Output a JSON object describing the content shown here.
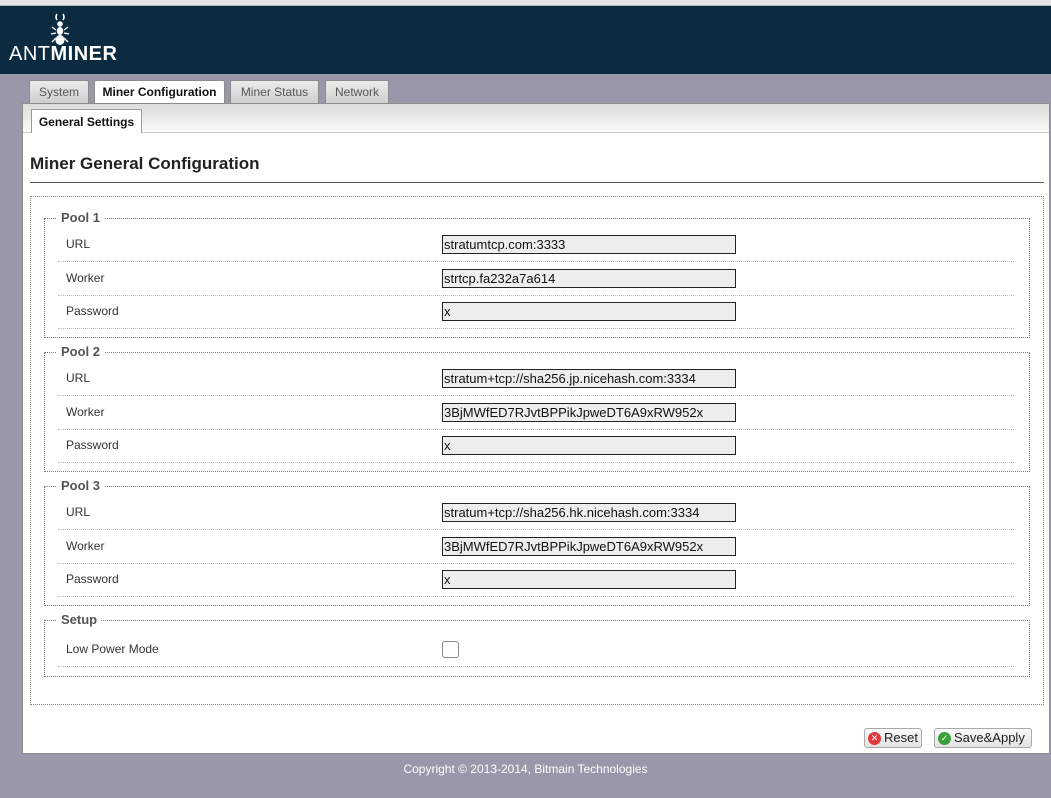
{
  "header": {
    "logo_thin": "ANT",
    "logo_bold": "MINER"
  },
  "tabs": [
    {
      "label": "System",
      "active": false
    },
    {
      "label": "Miner Configuration",
      "active": true
    },
    {
      "label": "Miner Status",
      "active": false
    },
    {
      "label": "Network",
      "active": false
    }
  ],
  "subtabs": [
    {
      "label": "General Settings",
      "active": true
    }
  ],
  "page_title": "Miner General Configuration",
  "pools": [
    {
      "legend": "Pool 1",
      "url_label": "URL",
      "url": "stratumtcp.com:3333",
      "worker_label": "Worker",
      "worker": "strtcp.fa232a7a614",
      "password_label": "Password",
      "password": "x"
    },
    {
      "legend": "Pool 2",
      "url_label": "URL",
      "url": "stratum+tcp://sha256.jp.nicehash.com:3334",
      "worker_label": "Worker",
      "worker": "3BjMWfED7RJvtBPPikJpweDT6A9xRW952x",
      "password_label": "Password",
      "password": "x"
    },
    {
      "legend": "Pool 3",
      "url_label": "URL",
      "url": "stratum+tcp://sha256.hk.nicehash.com:3334",
      "worker_label": "Worker",
      "worker": "3BjMWfED7RJvtBPPikJpweDT6A9xRW952x",
      "password_label": "Password",
      "password": "x"
    }
  ],
  "setup": {
    "legend": "Setup",
    "low_power_label": "Low Power Mode",
    "low_power_checked": false
  },
  "buttons": {
    "reset_label": "Reset",
    "save_label": "Save&Apply"
  },
  "icons": {
    "reset": "reset-x-icon",
    "save": "check-icon"
  },
  "colors": {
    "header_bg": "#0d2b40",
    "page_bg": "#9a97aa",
    "reset_icon": "#e0393b",
    "save_icon": "#3aa13a"
  },
  "footer": "Copyright © 2013-2014, Bitmain Technologies"
}
